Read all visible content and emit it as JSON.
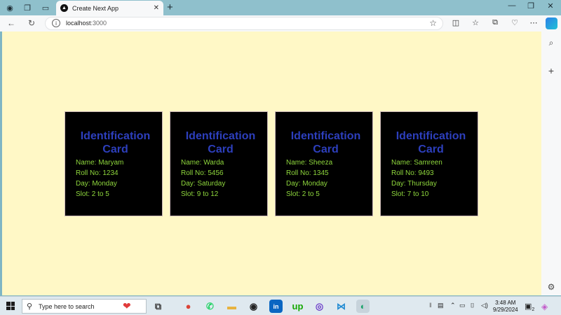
{
  "browser": {
    "tab_title": "Create Next App",
    "tab_favicon": "▲",
    "url_host": "localhost",
    "url_port": ":3000"
  },
  "cards": [
    {
      "title": "Identification Card",
      "name": "Name: Maryam",
      "roll": "Roll No: 1234",
      "day": "Day: Monday",
      "slot": "Slot: 2 to 5"
    },
    {
      "title": "Identification Card",
      "name": "Name: Warda",
      "roll": "Roll No: 5456",
      "day": "Day: Saturday",
      "slot": "Slot: 9 to 12"
    },
    {
      "title": "Identification Card",
      "name": "Name: Sheeza",
      "roll": "Roll No: 1345",
      "day": "Day: Monday",
      "slot": "Slot: 2 to 5"
    },
    {
      "title": "Identification Card",
      "name": "Name: Samreen",
      "roll": "Roll No: 9493",
      "day": "Day: Thursday",
      "slot": "Slot: 7 to 10"
    }
  ],
  "taskbar": {
    "search_placeholder": "Type here to search",
    "time": "3:48 AM",
    "date": "9/29/2024",
    "notification_count": "2",
    "apps": [
      {
        "name": "task-view",
        "glyph": "⧉",
        "color": "#444444"
      },
      {
        "name": "chrome",
        "glyph": "●",
        "color": "#db4437"
      },
      {
        "name": "whatsapp",
        "glyph": "✆",
        "color": "#25d366"
      },
      {
        "name": "file-explorer",
        "glyph": "▬",
        "color": "#e8b23c"
      },
      {
        "name": "github",
        "glyph": "◉",
        "color": "#222222"
      },
      {
        "name": "linkedin",
        "glyph": "in",
        "color": "#0a66c2"
      },
      {
        "name": "upwork",
        "glyph": "up",
        "color": "#14a800"
      },
      {
        "name": "github-desktop",
        "glyph": "◎",
        "color": "#6e40c9"
      },
      {
        "name": "vscode",
        "glyph": "⋈",
        "color": "#1f8ad2"
      },
      {
        "name": "edge",
        "glyph": "◐",
        "color": "#1ba36b"
      }
    ]
  },
  "colors": {
    "page_background": "#fff8c6",
    "card_background": "#000000",
    "card_title": "#2d3fbd",
    "card_text": "#8fd83d"
  }
}
